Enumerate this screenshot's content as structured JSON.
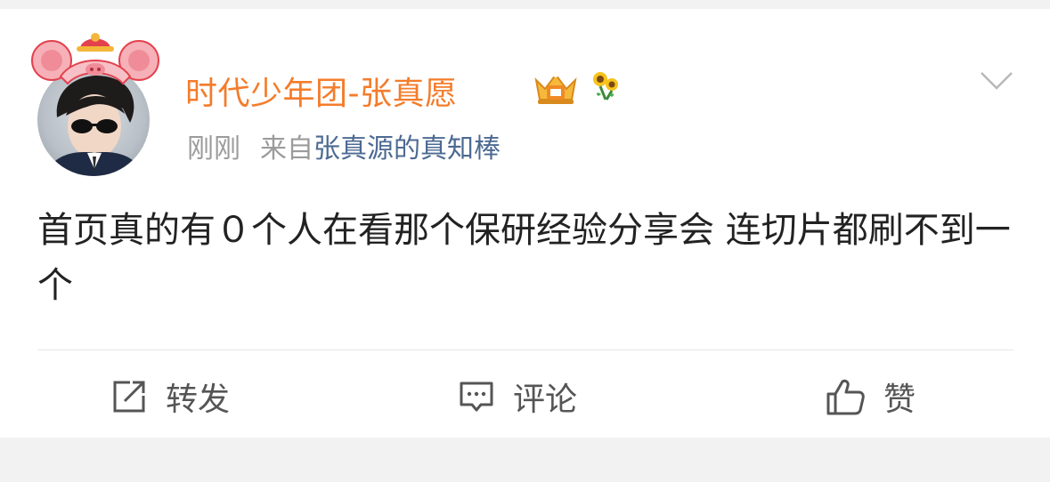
{
  "post": {
    "username": "时代少年团-张真愿",
    "time": "刚刚",
    "source_prefix": "来自",
    "source_name": "张真源的真知棒",
    "content": "首页真的有０个人在看那个保研经验分享会 连切片都刷不到一个"
  },
  "actions": {
    "repost_label": "转发",
    "comment_label": "评论",
    "like_label": "赞"
  },
  "icons": {
    "more": "chevron-down-icon",
    "repost": "repost-icon",
    "comment": "comment-icon",
    "like": "thumbs-up-icon",
    "crown": "crown-badge-icon",
    "flower": "sunflower-badge-icon"
  },
  "colors": {
    "username": "#f47c2b",
    "source_link": "#4d6a92",
    "meta": "#9b9b9b",
    "text": "#222222",
    "background": "#f2f2f2"
  }
}
